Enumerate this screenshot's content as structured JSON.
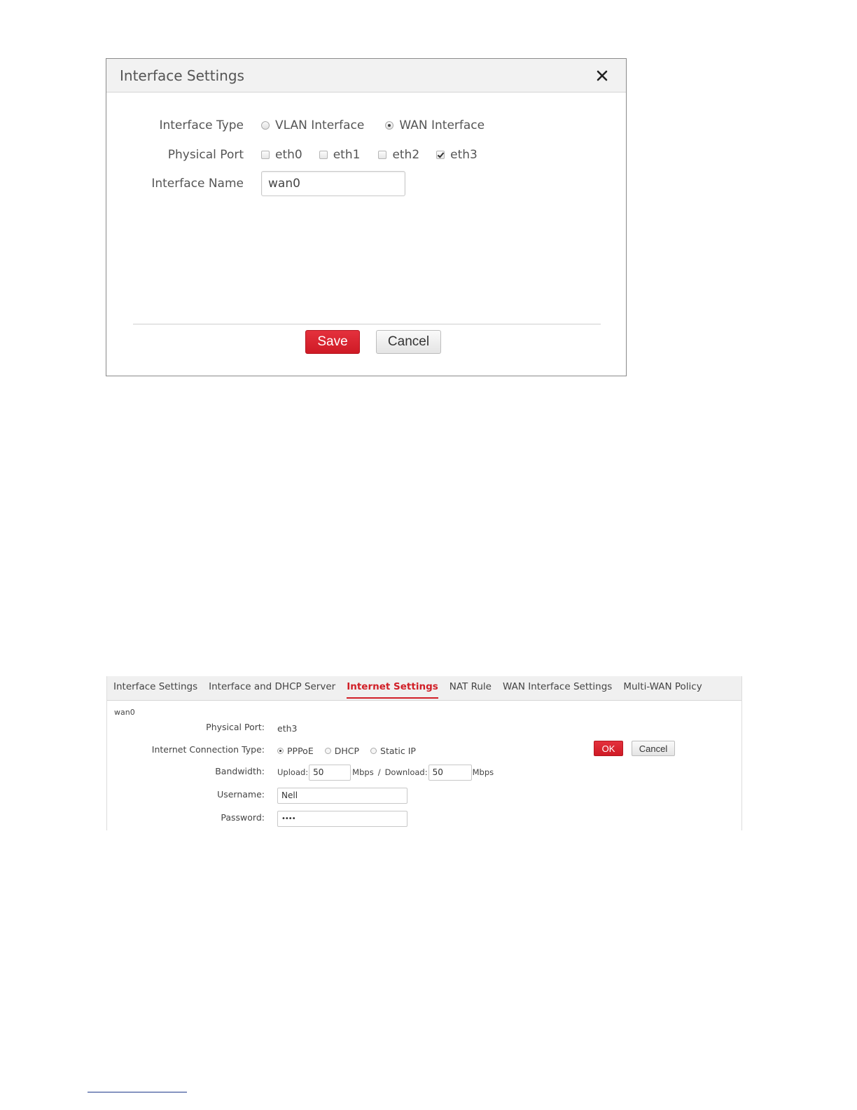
{
  "dialog": {
    "title": "Interface Settings",
    "interface_type": {
      "label": "Interface Type",
      "options": [
        {
          "label": "VLAN Interface",
          "selected": false
        },
        {
          "label": "WAN Interface",
          "selected": true
        }
      ]
    },
    "physical_port": {
      "label": "Physical Port",
      "ports": [
        {
          "label": "eth0",
          "checked": false
        },
        {
          "label": "eth1",
          "checked": false
        },
        {
          "label": "eth2",
          "checked": false
        },
        {
          "label": "eth3",
          "checked": true
        }
      ]
    },
    "interface_name": {
      "label": "Interface Name",
      "value": "wan0"
    },
    "save_label": "Save",
    "cancel_label": "Cancel",
    "accent_color": "#d11f27"
  },
  "panel": {
    "tabs": [
      {
        "label": "Interface Settings",
        "active": false
      },
      {
        "label": "Interface and DHCP Server",
        "active": false
      },
      {
        "label": "Internet Settings",
        "active": true
      },
      {
        "label": "NAT Rule",
        "active": false
      },
      {
        "label": "WAN Interface Settings",
        "active": false
      },
      {
        "label": "Multi-WAN Policy",
        "active": false
      }
    ],
    "section": "wan0",
    "physical_port": {
      "label": "Physical Port:",
      "value": "eth3"
    },
    "connection_type": {
      "label": "Internet Connection Type:",
      "options": [
        {
          "label": "PPPoE",
          "selected": true
        },
        {
          "label": "DHCP",
          "selected": false
        },
        {
          "label": "Static IP",
          "selected": false
        }
      ]
    },
    "bandwidth": {
      "label": "Bandwidth:",
      "upload_label": "Upload:",
      "upload_value": "50",
      "upload_unit": "Mbps",
      "separator": "/",
      "download_label": "Download:",
      "download_value": "50",
      "download_unit": "Mbps"
    },
    "username": {
      "label": "Username:",
      "value": "Nell"
    },
    "password": {
      "label": "Password:",
      "value": "••••"
    },
    "ok_label": "OK",
    "cancel_label": "Cancel"
  }
}
